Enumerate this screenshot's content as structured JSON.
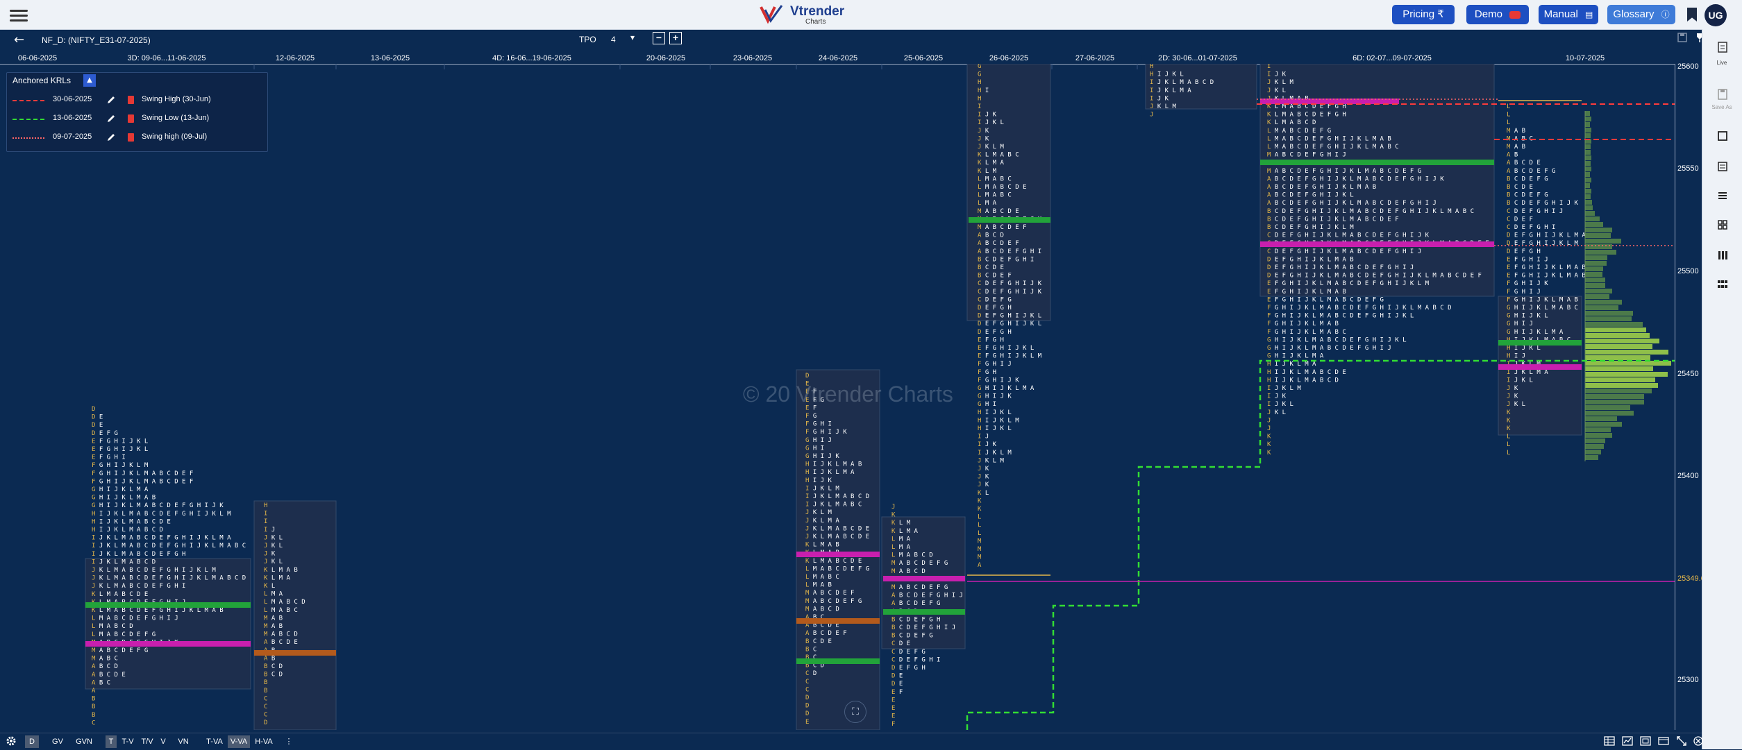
{
  "header": {
    "logo_text": "Vtrender",
    "logo_sub": "Charts",
    "buttons": [
      {
        "label": "Pricing ₹"
      },
      {
        "label": "Demo"
      },
      {
        "label": "Manual"
      },
      {
        "label": "Glossary"
      }
    ],
    "avatar": "UG"
  },
  "toolbar": {
    "symbol": "NF_D: (NIFTY_E31-07-2025)",
    "tpo_label": "TPO",
    "tpo_value": "4"
  },
  "dates": [
    "06-06-2025",
    "3D: 09-06...11-06-2025",
    "12-06-2025",
    "13-06-2025",
    "4D: 16-06...19-06-2025",
    "20-06-2025",
    "23-06-2025",
    "24-06-2025",
    "25-06-2025",
    "26-06-2025",
    "27-06-2025",
    "2D: 30-06...01-07-2025",
    "6D: 02-07...09-07-2025",
    "10-07-2025"
  ],
  "prices": [
    "25600",
    "25550",
    "25500",
    "25450",
    "25400",
    "25349.60",
    "25300"
  ],
  "krl": {
    "title": "Anchored KRLs",
    "items": [
      {
        "date": "30-06-2025",
        "label": "Swing High (30-Jun)",
        "color": "#ff3b3b"
      },
      {
        "date": "13-06-2025",
        "label": "Swing Low (13-Jun)",
        "color": "#33dd33"
      },
      {
        "date": "09-07-2025",
        "label": "Swing high (09-Jul)",
        "color": "#ff6666"
      }
    ]
  },
  "watermark": "© 20  Vtrender Charts",
  "right_sidebar": {
    "live": "Live",
    "save_as": "Save As"
  },
  "bottom": {
    "items": [
      "D",
      "GV",
      "GVN",
      "T",
      "T-V",
      "T/V",
      "V",
      "VN",
      "T-VA",
      "V-VA",
      "H-VA"
    ]
  },
  "colors": {
    "bg": "#0b2a52",
    "poc_magenta": "#c81fae",
    "va_green": "#22a33a",
    "ib_yellow": "#e6b84a",
    "tpo_text": "#ffffff"
  }
}
